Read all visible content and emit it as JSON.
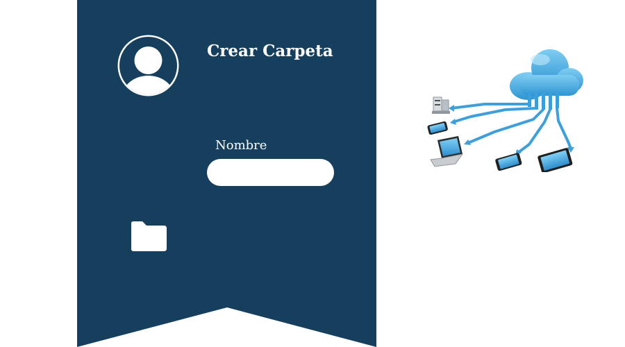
{
  "form": {
    "title": "Crear Carpeta",
    "name_label": "Nombre",
    "name_value": "",
    "name_placeholder": ""
  },
  "icons": {
    "avatar": "user-avatar-icon",
    "folder": "folder-icon",
    "illustration": "cloud-network-illustration"
  },
  "colors": {
    "panel": "#163f5e",
    "text": "#ffffff",
    "accent": "#4aaee3"
  }
}
